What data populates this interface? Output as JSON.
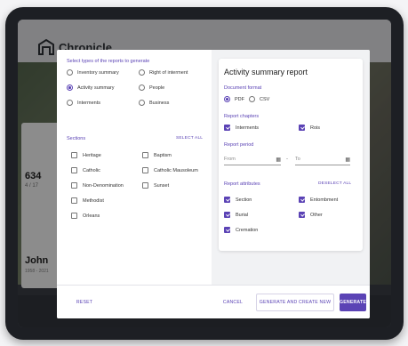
{
  "background_app": {
    "title": "Chronicle",
    "count": "634",
    "count_sub": "4 / 17",
    "person_name": "John",
    "person_sub": "1958 - 2021"
  },
  "report_types": {
    "title": "Select types of the reports to generate",
    "options": [
      {
        "label": "Inventory summary",
        "selected": false
      },
      {
        "label": "Right of interment",
        "selected": false
      },
      {
        "label": "Activity summary",
        "selected": true
      },
      {
        "label": "People",
        "selected": false
      },
      {
        "label": "Interments",
        "selected": false
      },
      {
        "label": "Business",
        "selected": false
      }
    ]
  },
  "sections": {
    "title": "Sections",
    "select_all": "SELECT ALL",
    "items": [
      {
        "label": "Heritage",
        "checked": false
      },
      {
        "label": "Baptism",
        "checked": false
      },
      {
        "label": "Catholic",
        "checked": false
      },
      {
        "label": "Catholic Mausoleum",
        "checked": false
      },
      {
        "label": "Non-Denomination",
        "checked": false
      },
      {
        "label": "Sunset",
        "checked": false
      },
      {
        "label": "Methodist",
        "checked": false
      },
      {
        "label": "Orleans",
        "checked": false
      }
    ]
  },
  "report_panel": {
    "title": "Activity summary report",
    "document_format": {
      "title": "Document format",
      "options": [
        {
          "label": "PDF",
          "selected": true
        },
        {
          "label": "CSV",
          "selected": false
        }
      ]
    },
    "report_chapters": {
      "title": "Report chapters",
      "items": [
        {
          "label": "Interments",
          "checked": true
        },
        {
          "label": "Rois",
          "checked": true
        }
      ]
    },
    "report_period": {
      "title": "Report period",
      "from_placeholder": "From",
      "to_placeholder": "To",
      "separator": "-"
    },
    "report_attributes": {
      "title": "Report attributes",
      "deselect_all": "DESELECT ALL",
      "items": [
        {
          "label": "Section",
          "checked": true
        },
        {
          "label": "Entombment",
          "checked": true
        },
        {
          "label": "Burial",
          "checked": true
        },
        {
          "label": "Other",
          "checked": true
        },
        {
          "label": "Cremation",
          "checked": true
        }
      ]
    }
  },
  "footer": {
    "reset": "RESET",
    "cancel": "CANCEL",
    "generate_and_create_new": "GENERATE AND CREATE NEW",
    "generate": "GENERATE"
  },
  "colors": {
    "accent": "#5b43b5"
  },
  "icons": {
    "logo": "chronicle-logo-icon",
    "calendar": "calendar-icon"
  }
}
